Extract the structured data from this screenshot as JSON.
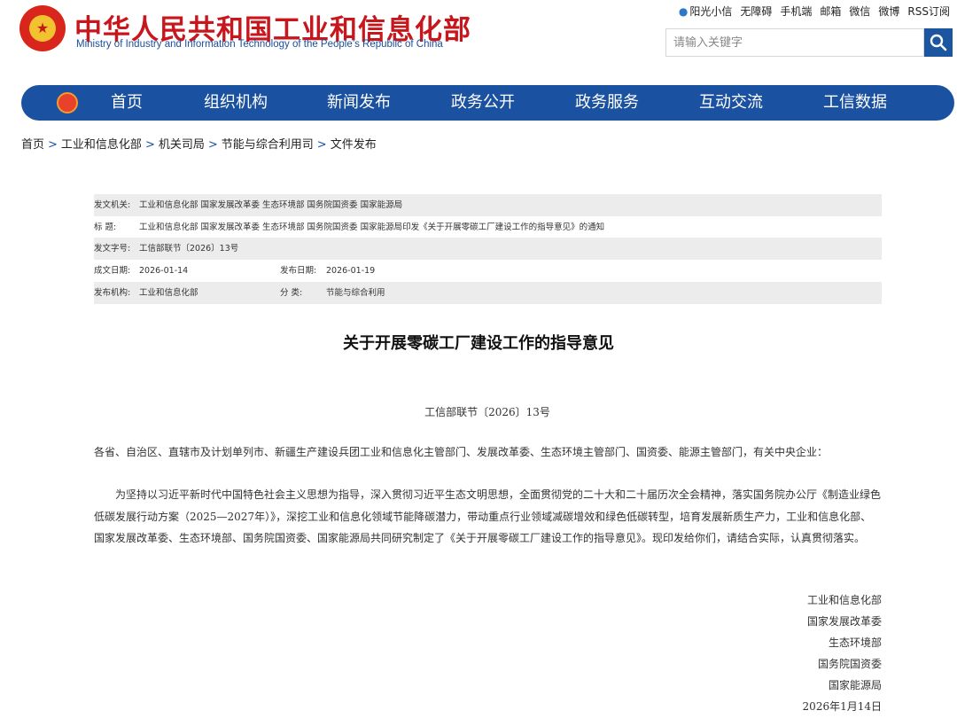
{
  "header": {
    "site_name_cn": "中华人民共和国工业和信息化部",
    "site_name_en": "Ministry of Industry and Information Technology of the People’s Republic of China",
    "top_links": [
      "阳光小信",
      "无障碍",
      "手机端",
      "邮箱",
      "微信",
      "微博",
      "RSS订阅"
    ],
    "search_placeholder": "请输入关键字"
  },
  "nav": {
    "items": [
      "首页",
      "组织机构",
      "新闻发布",
      "政务公开",
      "政务服务",
      "互动交流",
      "工信数据"
    ]
  },
  "breadcrumb": [
    "首页",
    "工业和信息化部",
    "机关司局",
    "节能与综合利用司",
    "文件发布"
  ],
  "breadcrumb_sep": ">",
  "info": {
    "issuer_label": "发文机关:",
    "issuer_value": "工业和信息化部 国家发展改革委 生态环境部 国务院国资委 国家能源局",
    "title_label": "标 题:",
    "title_value": "工业和信息化部 国家发展改革委 生态环境部 国务院国资委 国家能源局印发《关于开展零碳工厂建设工作的指导意见》的通知",
    "docno_label": "发文字号:",
    "docno_value": "工信部联节〔2026〕13号",
    "created_label": "成文日期:",
    "created_value": "2026-01-14",
    "published_label": "发布日期:",
    "published_value": "2026-01-19",
    "org_label": "发布机构:",
    "org_value": "工业和信息化部",
    "category_label": "分 类:",
    "category_value": "节能与综合利用"
  },
  "article": {
    "title": "关于开展零碳工厂建设工作的指导意见",
    "doc_number": "工信部联节〔2026〕13号",
    "para1": "各省、自治区、直辖市及计划单列市、新疆生产建设兵团工业和信息化主管部门、发展改革委、生态环境主管部门、国资委、能源主管部门，有关中央企业：",
    "para2": "为坚持以习近平新时代中国特色社会主义思想为指导，深入贯彻习近平生态文明思想，全面贯彻党的二十大和二十届历次全会精神，落实国务院办公厅《制造业绿色低碳发展行动方案（2025—2027年）》，深挖工业和信息化领域节能降碳潜力，带动重点行业领域减碳增效和绿色低碳转型，培育发展新质生产力，工业和信息化部、国家发展改革委、生态环境部、国务院国资委、国家能源局共同研究制定了《关于开展零碳工厂建设工作的指导意见》。现印发给你们，请结合实际，认真贯彻落实。",
    "signatures": [
      "工业和信息化部",
      "国家发展改革委",
      "生态环境部",
      "国务院国资委",
      "国家能源局"
    ],
    "date": "2026年1月14日"
  },
  "colors": {
    "brand_red": "#c8161d",
    "nav_blue": "#1a51a0"
  }
}
